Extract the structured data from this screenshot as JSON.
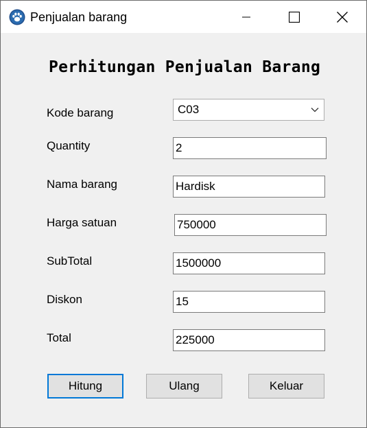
{
  "window": {
    "title": "Penjualan barang",
    "icon": "paw-icon"
  },
  "form": {
    "heading": "Perhitungan Penjualan Barang",
    "kode_barang": {
      "label": "Kode barang",
      "value": "C03"
    },
    "quantity": {
      "label": "Quantity",
      "value": "2"
    },
    "nama_barang": {
      "label": "Nama barang",
      "value": "Hardisk"
    },
    "harga_satuan": {
      "label": "Harga satuan",
      "value": "750000"
    },
    "subtotal": {
      "label": "SubTotal",
      "value": "1500000"
    },
    "diskon": {
      "label": "Diskon",
      "value": "15"
    },
    "total": {
      "label": "Total",
      "value": "225000"
    }
  },
  "buttons": {
    "hitung": "Hitung",
    "ulang": "Ulang",
    "keluar": "Keluar"
  },
  "colors": {
    "accent": "#0078d7",
    "window_bg": "#f0f0f0",
    "button_bg": "#e1e1e1"
  }
}
